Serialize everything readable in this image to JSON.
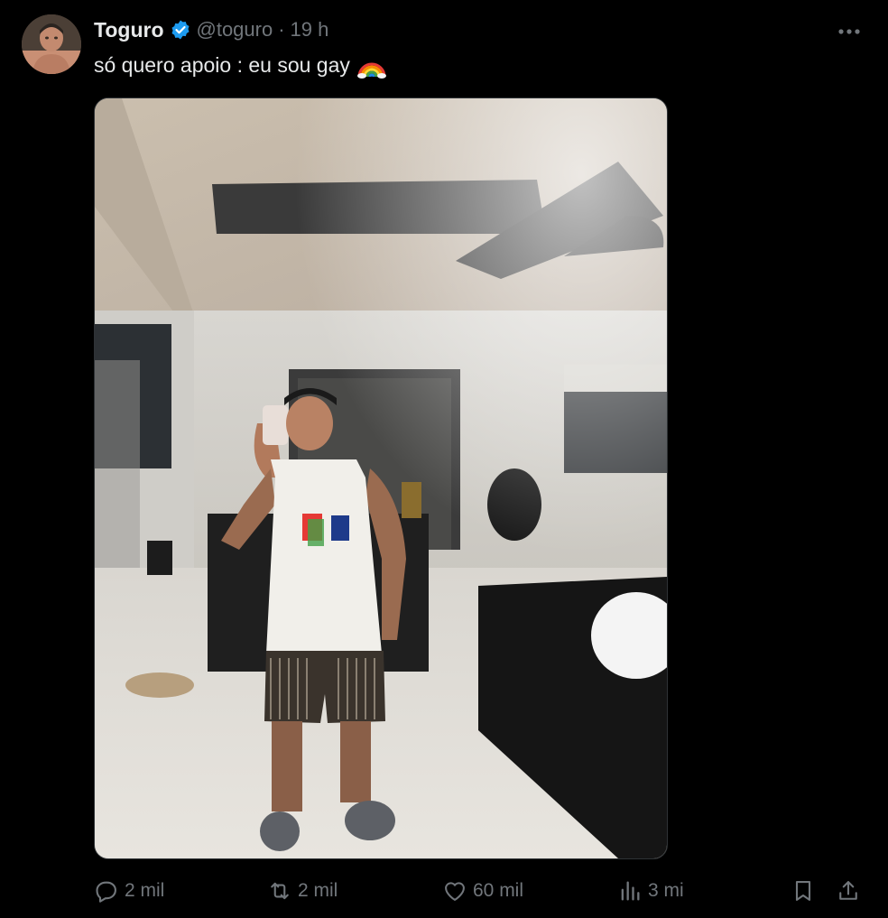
{
  "user": {
    "name": "Toguro",
    "handle": "@toguro",
    "separator": "·",
    "time": "19 h",
    "verified_color": "#1d9bf0"
  },
  "tweet": {
    "text": "só quero apoio : eu sou gay"
  },
  "icons": {
    "more": "more-horizontal-icon",
    "text_emoji": "rainbow-emoji",
    "reply": "reply-bubble-icon",
    "retweet": "retweet-icon",
    "like": "heart-icon",
    "views": "views-bar-chart-icon",
    "bookmark": "bookmark-icon",
    "share": "share-icon"
  },
  "stats": {
    "replies": "2 mil",
    "retweets": "2 mil",
    "likes": "60 mil",
    "views": "3 mi"
  },
  "colors": {
    "background": "#000000",
    "text": "#e7e9ea",
    "muted": "#71767b",
    "accent": "#1d9bf0"
  }
}
